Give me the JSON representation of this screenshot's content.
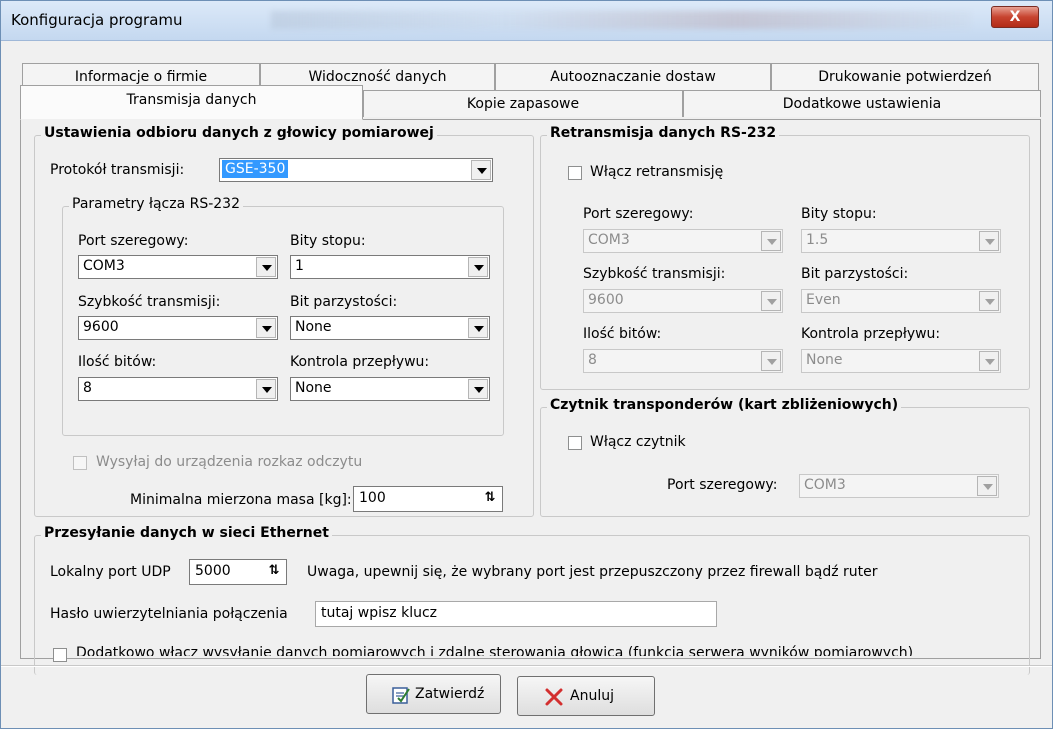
{
  "window": {
    "title": "Konfiguracja programu",
    "close_label": "X"
  },
  "tabs": {
    "row1": [
      "Informacje o firmie",
      "Widoczność danych",
      "Autooznaczanie dostaw",
      "Drukowanie potwierdzeń"
    ],
    "row2": [
      "Transmisja danych",
      "Kopie zapasowe",
      "Dodatkowe ustawienia"
    ],
    "selected": "Transmisja danych"
  },
  "receive": {
    "title": "Ustawienia odbioru danych z głowicy pomiarowej",
    "protocol_label": "Protokół transmisji:",
    "protocol_value": "GSE-350",
    "rs232": {
      "title": "Parametry łącza RS-232",
      "port_label": "Port szeregowy:",
      "port_value": "COM3",
      "stopbits_label": "Bity stopu:",
      "stopbits_value": "1",
      "speed_label": "Szybkość transmisji:",
      "speed_value": "9600",
      "parity_label": "Bit parzystości:",
      "parity_value": "None",
      "databits_label": "Ilość bitów:",
      "databits_value": "8",
      "flow_label": "Kontrola przepływu:",
      "flow_value": "None"
    },
    "send_read_cmd_label": "Wysyłaj do urządzenia rozkaz odczytu",
    "min_mass_label": "Minimalna mierzona masa [kg]:",
    "min_mass_value": "100"
  },
  "retransmit": {
    "title": "Retransmisja danych RS-232",
    "enable_label": "Włącz retransmisję",
    "port_label": "Port szeregowy:",
    "port_value": "COM3",
    "stopbits_label": "Bity stopu:",
    "stopbits_value": "1.5",
    "speed_label": "Szybkość transmisji:",
    "speed_value": "9600",
    "parity_label": "Bit parzystości:",
    "parity_value": "Even",
    "databits_label": "Ilość bitów:",
    "databits_value": "8",
    "flow_label": "Kontrola przepływu:",
    "flow_value": "None"
  },
  "reader": {
    "title": "Czytnik transponderów (kart zbliżeniowych)",
    "enable_label": "Włącz czytnik",
    "port_label": "Port szeregowy:",
    "port_value": "COM3"
  },
  "ethernet": {
    "title": "Przesyłanie danych w sieci Ethernet",
    "udp_label": "Lokalny port UDP",
    "udp_value": "5000",
    "udp_warning": "Uwaga, upewnij się, że wybrany port jest przepuszczony przez firewall bądź ruter",
    "password_label": "Hasło uwierzytelniania połączenia",
    "password_value": "tutaj wpisz klucz",
    "server_label": "Dodatkowo włącz wysyłanie danych pomiarowych i zdalne sterowania głowicą (funkcja serwera wyników pomiarowych)"
  },
  "buttons": {
    "ok_label": "Zatwierdź",
    "cancel_label": "Anuluj"
  }
}
